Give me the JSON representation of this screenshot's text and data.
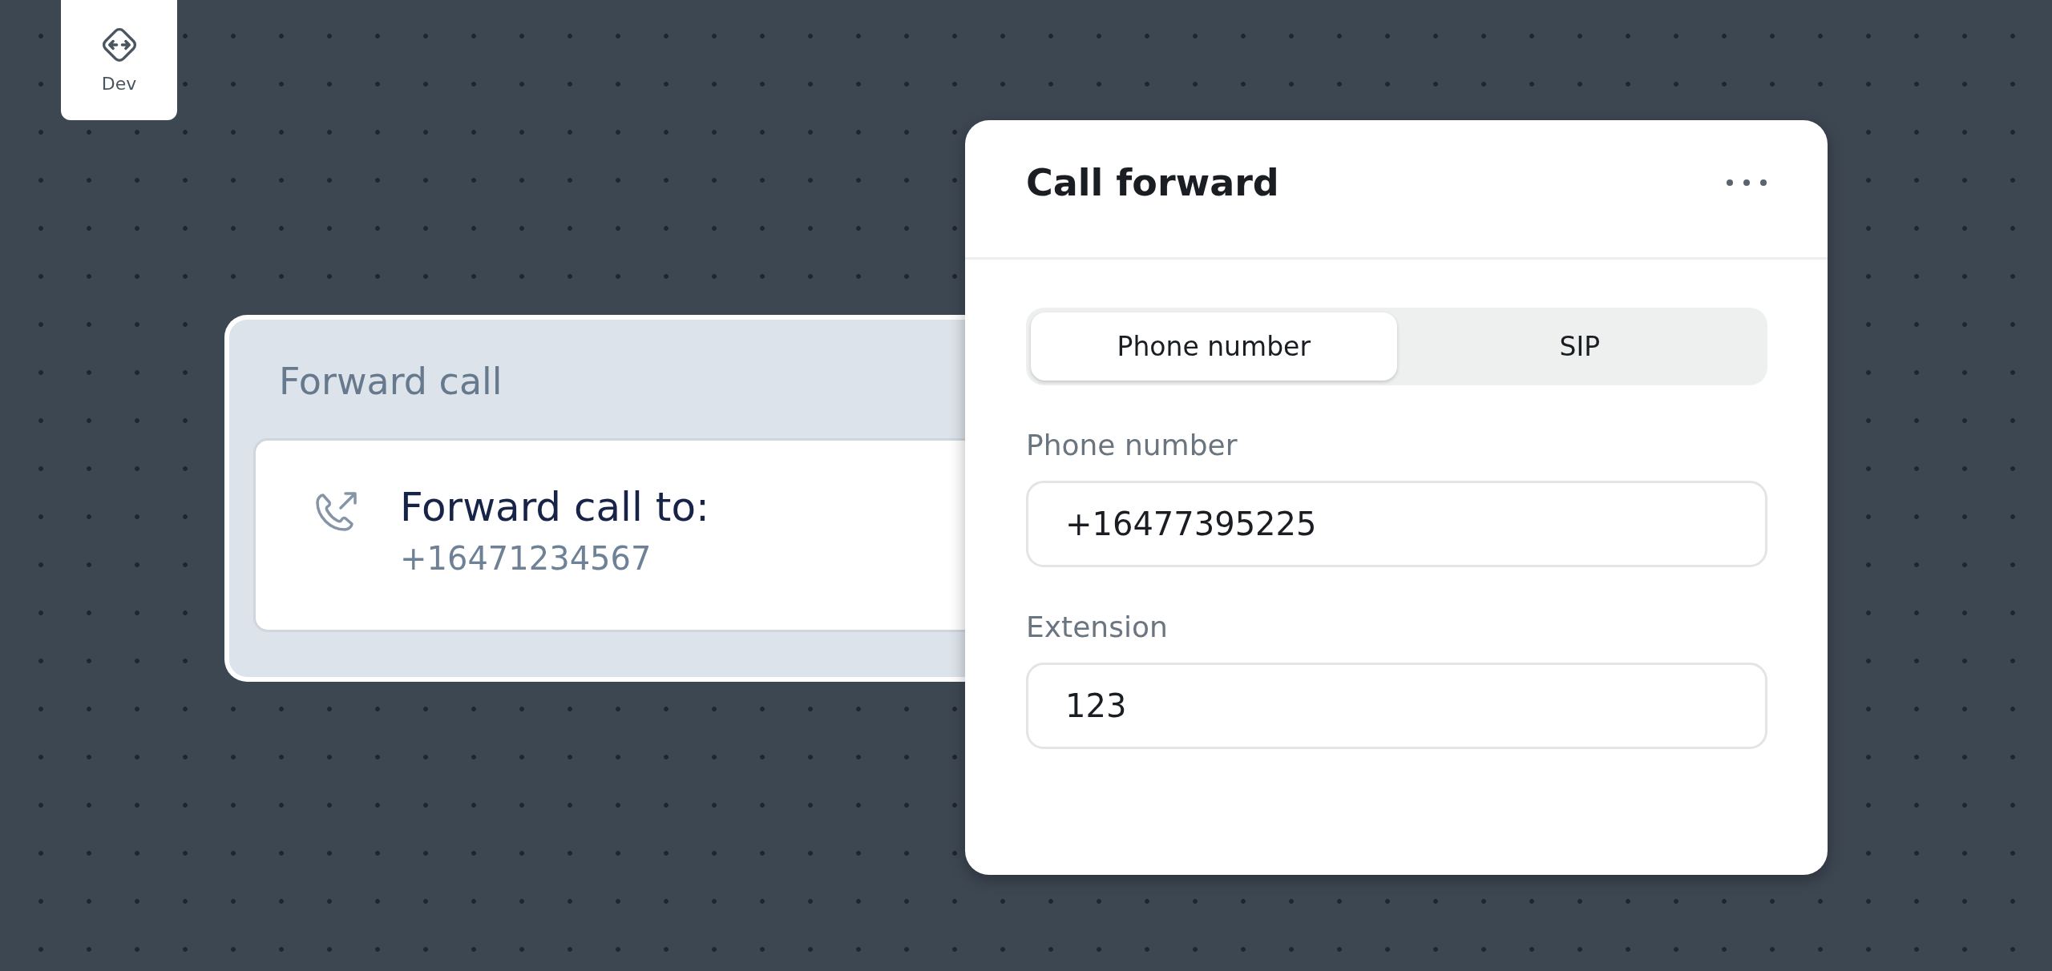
{
  "dev_badge": {
    "label": "Dev"
  },
  "node": {
    "title": "Forward call",
    "action": "Forward call to:",
    "value": "+16471234567"
  },
  "panel": {
    "title": "Call forward",
    "tabs": [
      {
        "label": "Phone number",
        "selected": true
      },
      {
        "label": "SIP",
        "selected": false
      }
    ],
    "fields": [
      {
        "label": "Phone number",
        "value": "+16477395225"
      },
      {
        "label": "Extension",
        "value": "123"
      }
    ]
  }
}
